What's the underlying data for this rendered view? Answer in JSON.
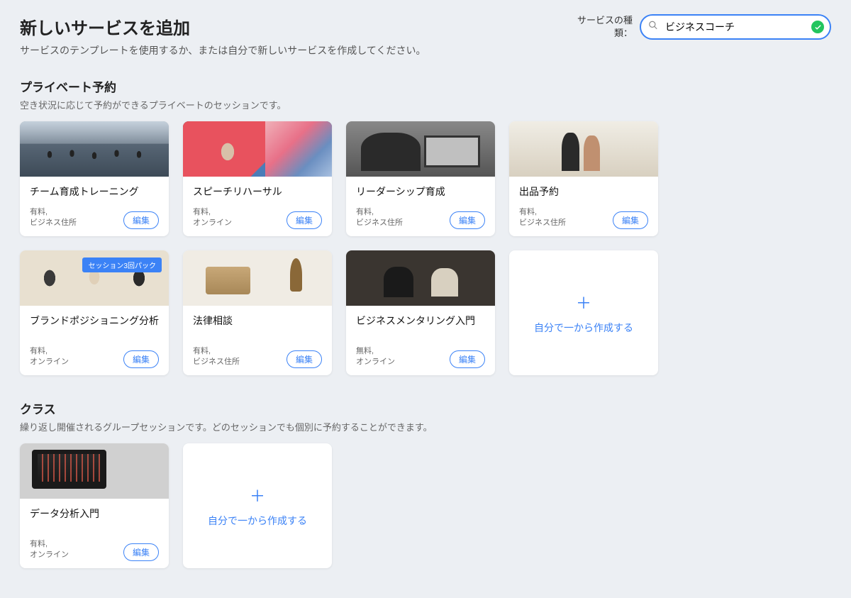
{
  "header": {
    "title": "新しいサービスを追加",
    "subtitle": "サービスのテンプレートを使用するか、または自分で新しいサービスを作成してください。"
  },
  "search": {
    "label_line1": "サービスの種",
    "label_line2": "類：",
    "value": "ビジネスコーチ"
  },
  "sections": {
    "private": {
      "title": "プライベート予約",
      "subtitle": "空き状況に応じて予約ができるプライベートのセッションです。",
      "cards": [
        {
          "title": "チーム育成トレーニング",
          "meta1": "有料,",
          "meta2": "ビジネス住所",
          "edit": "編集",
          "img": "img-meeting"
        },
        {
          "title": "スピーチリハーサル",
          "meta1": "有料,",
          "meta2": "オンライン",
          "edit": "編集",
          "img": "img-speech"
        },
        {
          "title": "リーダーシップ育成",
          "meta1": "有料,",
          "meta2": "ビジネス住所",
          "edit": "編集",
          "img": "img-leader"
        },
        {
          "title": "出品予約",
          "meta1": "有料,",
          "meta2": "ビジネス住所",
          "edit": "編集",
          "img": "img-listing"
        },
        {
          "title": "ブランドポジショニング分析",
          "meta1": "有料,",
          "meta2": "オンライン",
          "edit": "編集",
          "img": "img-brand",
          "badge": "セッション3回パック"
        },
        {
          "title": "法律相談",
          "meta1": "有料,",
          "meta2": "ビジネス住所",
          "edit": "編集",
          "img": "img-legal"
        },
        {
          "title": "ビジネスメンタリング入門",
          "meta1": "無料,",
          "meta2": "オンライン",
          "edit": "編集",
          "img": "img-mentor"
        }
      ],
      "create": "自分で一から作成する"
    },
    "class": {
      "title": "クラス",
      "subtitle": "繰り返し開催されるグループセッションです。どのセッションでも個別に予約することができます。",
      "cards": [
        {
          "title": "データ分析入門",
          "meta1": "有料,",
          "meta2": "オンライン",
          "edit": "編集",
          "img": "img-data"
        }
      ],
      "create": "自分で一から作成する"
    }
  }
}
